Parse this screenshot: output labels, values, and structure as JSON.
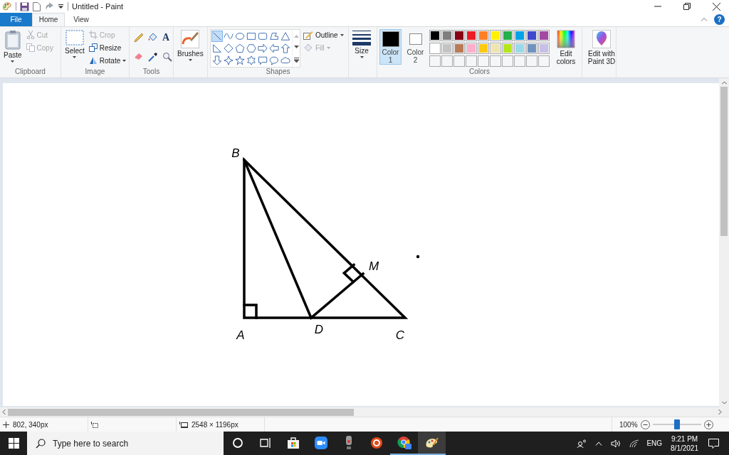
{
  "window": {
    "title": "Untitled - Paint"
  },
  "tabs": [
    {
      "label": "File",
      "selected": false,
      "kind": "file"
    },
    {
      "label": "Home",
      "selected": true,
      "kind": "tab"
    },
    {
      "label": "View",
      "selected": false,
      "kind": "tab"
    }
  ],
  "help": "?",
  "clipboard": {
    "label": "Clipboard",
    "paste": "Paste",
    "items": [
      {
        "label": "Cut",
        "disabled": true
      },
      {
        "label": "Copy",
        "disabled": true
      }
    ]
  },
  "image": {
    "label": "Image",
    "select": "Select",
    "items": [
      {
        "label": "Crop",
        "disabled": true,
        "caret": false
      },
      {
        "label": "Resize",
        "disabled": false,
        "caret": false
      },
      {
        "label": "Rotate",
        "disabled": false,
        "caret": true
      }
    ]
  },
  "tools": {
    "label": "Tools",
    "text_tool": "A"
  },
  "brushes": {
    "label": "Brushes"
  },
  "shapes": {
    "label": "Shapes",
    "outline": {
      "label": "Outline",
      "disabled": false
    },
    "fill": {
      "label": "Fill",
      "disabled": true
    },
    "gallery": [
      {
        "selected": true
      },
      {
        "selected": false
      },
      {
        "selected": false
      },
      {
        "selected": false
      },
      {
        "selected": false
      },
      {
        "selected": false
      },
      {
        "selected": false
      },
      {
        "selected": false
      },
      {
        "selected": false
      },
      {
        "selected": false
      },
      {
        "selected": false
      },
      {
        "selected": false
      },
      {
        "selected": false
      },
      {
        "selected": false
      },
      {
        "selected": false
      },
      {
        "selected": false
      },
      {
        "selected": false
      },
      {
        "selected": false
      },
      {
        "selected": false
      },
      {
        "selected": false
      },
      {
        "selected": false
      }
    ]
  },
  "size": {
    "label": "Size"
  },
  "colors": {
    "label": "Colors",
    "slots": [
      {
        "label": "Color",
        "number": "1",
        "color": "#000000",
        "selected": true
      },
      {
        "label": "Color",
        "number": "2",
        "color": "#ffffff",
        "selected": false
      }
    ],
    "palette": [
      {
        "color": "#000000"
      },
      {
        "color": "#7f7f7f"
      },
      {
        "color": "#880015"
      },
      {
        "color": "#ed1c24"
      },
      {
        "color": "#ff7f27"
      },
      {
        "color": "#fff200"
      },
      {
        "color": "#22b14c"
      },
      {
        "color": "#00a2e8"
      },
      {
        "color": "#3f48cc"
      },
      {
        "color": "#a349a4"
      },
      {
        "color": "#ffffff"
      },
      {
        "color": "#c3c3c3"
      },
      {
        "color": "#b97a57"
      },
      {
        "color": "#ffaec9"
      },
      {
        "color": "#ffc90e"
      },
      {
        "color": "#efe4b0"
      },
      {
        "color": "#b5e61d"
      },
      {
        "color": "#99d9ea"
      },
      {
        "color": "#7092be"
      },
      {
        "color": "#c8bfe7"
      }
    ],
    "edit_colors": "Edit colors"
  },
  "paint3d": "Edit with Paint 3D",
  "canvas": {
    "point_labels": [
      "B",
      "M",
      "A",
      "D",
      "C"
    ]
  },
  "status_bar": {
    "cursor": "802, 340px",
    "canvas_size": "2548 × 1196px",
    "zoom": "100%",
    "zoom_level": {
      "level": 0.5
    }
  },
  "taskbar": {
    "search_placeholder": "Type here to search",
    "apps": [
      {
        "running": false,
        "selected": false
      },
      {
        "running": false,
        "selected": false
      },
      {
        "running": false,
        "selected": false
      },
      {
        "running": false,
        "selected": false
      },
      {
        "running": false,
        "selected": false
      },
      {
        "running": false,
        "selected": false
      },
      {
        "running": true,
        "selected": false
      },
      {
        "running": true,
        "selected": true
      }
    ],
    "language": "ENG",
    "time": "9:21 PM",
    "date": "8/1/2021"
  }
}
